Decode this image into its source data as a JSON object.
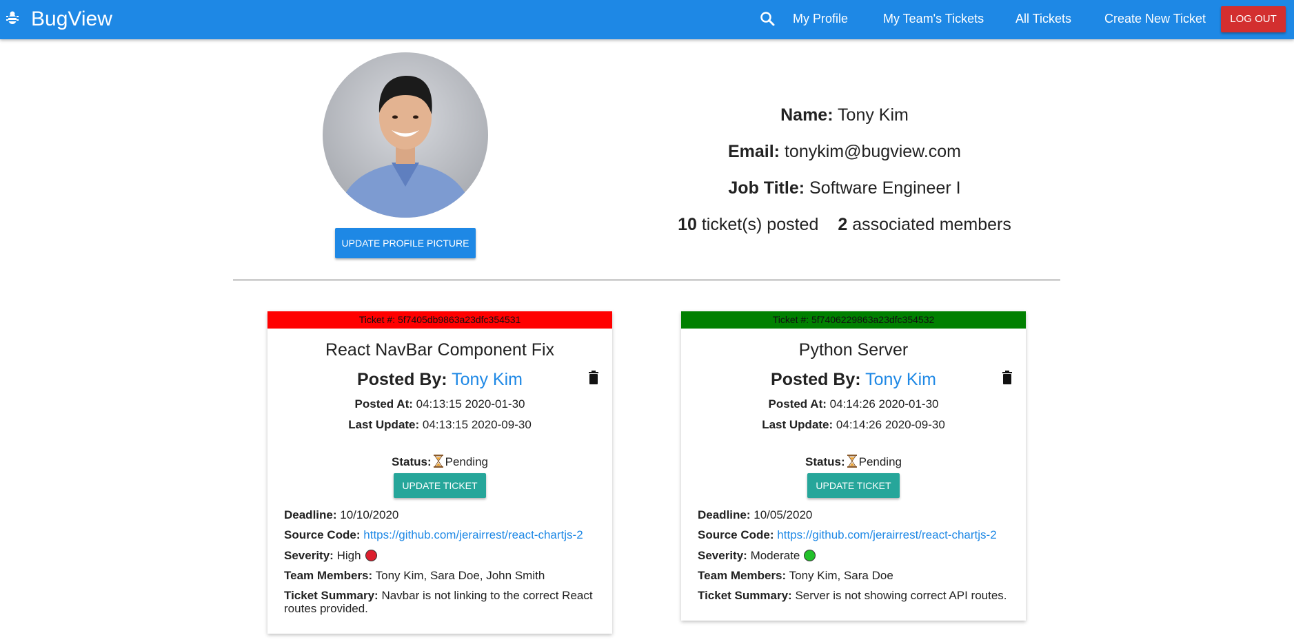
{
  "nav": {
    "brand": "BugView",
    "links": [
      "My Profile",
      "My Team's Tickets",
      "All Tickets",
      "Create New Ticket"
    ],
    "logout": "LOG OUT"
  },
  "profile": {
    "name_label": "Name:",
    "name": "Tony Kim",
    "email_label": "Email:",
    "email": "tonykim@bugview.com",
    "job_label": "Job Title:",
    "job": "Software Engineer I",
    "tickets_count": "10",
    "tickets_text": "ticket(s) posted",
    "members_count": "2",
    "members_text": "associated members",
    "update_button": "UPDATE PROFILE PICTURE"
  },
  "labels": {
    "ticket": "Ticket #:",
    "posted_by": "Posted By:",
    "posted_at": "Posted At:",
    "last_update": "Last Update:",
    "status": "Status:",
    "update_ticket": "UPDATE TICKET",
    "deadline": "Deadline:",
    "source_code": "Source Code:",
    "severity": "Severity:",
    "team_members": "Team Members:",
    "summary": "Ticket Summary:"
  },
  "tickets": [
    {
      "id": "5f7405db9863a23dfc354531",
      "header_color": "#ff0000",
      "title": "React NavBar Component Fix",
      "posted_by": "Tony Kim",
      "posted_at": "04:13:15 2020-01-30",
      "last_update": "04:13:15 2020-09-30",
      "status": "Pending",
      "deadline": "10/10/2020",
      "source_code": "https://github.com/jerairrest/react-chartjs-2",
      "severity": "High",
      "severity_color": "#dc1f2e",
      "team_members": "Tony Kim, Sara Doe, John Smith",
      "summary": "Navbar is not linking to the correct React routes provided."
    },
    {
      "id": "5f7406229863a23dfc354532",
      "header_color": "#008000",
      "title": "Python Server",
      "posted_by": "Tony Kim",
      "posted_at": "04:14:26 2020-01-30",
      "last_update": "04:14:26 2020-09-30",
      "status": "Pending",
      "deadline": "10/05/2020",
      "source_code": "https://github.com/jerairrest/react-chartjs-2",
      "severity": "Moderate",
      "severity_color": "#22c02a",
      "team_members": "Tony Kim, Sara Doe",
      "summary": "Server is not showing correct API routes."
    }
  ]
}
